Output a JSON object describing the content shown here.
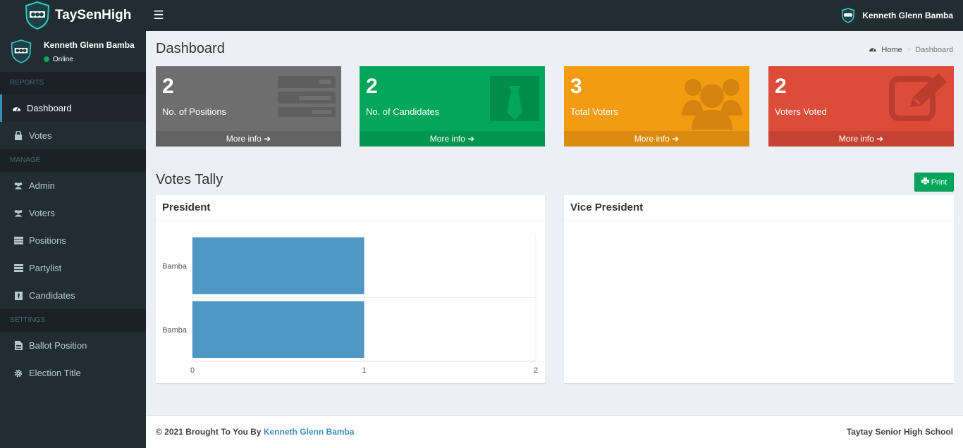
{
  "brand": {
    "name": "TaySenHigh"
  },
  "header": {
    "user_name": "Kenneth Glenn Bamba"
  },
  "sidebar": {
    "user_name": "Kenneth Glenn Bamba",
    "status": "Online",
    "sections": [
      {
        "title": "REPORTS",
        "items": [
          {
            "label": "Dashboard",
            "icon": "dashboard-icon"
          },
          {
            "label": "Votes",
            "icon": "lock-icon"
          }
        ]
      },
      {
        "title": "MANAGE",
        "items": [
          {
            "label": "Admin",
            "icon": "users-icon"
          },
          {
            "label": "Voters",
            "icon": "users-icon"
          },
          {
            "label": "Positions",
            "icon": "tasks-icon"
          },
          {
            "label": "Partylist",
            "icon": "tasks-icon"
          },
          {
            "label": "Candidates",
            "icon": "black-tie-icon"
          }
        ]
      },
      {
        "title": "SETTINGS",
        "items": [
          {
            "label": "Ballot Position",
            "icon": "file-text-icon"
          },
          {
            "label": "Election Title",
            "icon": "cog-icon"
          }
        ]
      }
    ]
  },
  "page": {
    "title": "Dashboard",
    "breadcrumb": {
      "home": "Home",
      "current": "Dashboard"
    }
  },
  "stats": [
    {
      "value": "2",
      "label": "No. of Positions",
      "more": "More info",
      "color": "#6e6e6e"
    },
    {
      "value": "2",
      "label": "No. of Candidates",
      "more": "More info",
      "color": "#00a65a"
    },
    {
      "value": "3",
      "label": "Total Voters",
      "more": "More info",
      "color": "#f39c12"
    },
    {
      "value": "2",
      "label": "Voters Voted",
      "more": "More info",
      "color": "#dd4b39"
    }
  ],
  "tally": {
    "title": "Votes Tally",
    "print_label": "Print"
  },
  "panels": [
    {
      "title": "President"
    },
    {
      "title": "Vice President"
    }
  ],
  "chart_data": {
    "type": "bar",
    "orientation": "horizontal",
    "categories": [
      "Bamba",
      "Bamba"
    ],
    "values": [
      1,
      1
    ],
    "xlim": [
      0,
      2
    ],
    "xticks": [
      0,
      1,
      2
    ],
    "color": "#4e96c4",
    "grid": true
  },
  "footer": {
    "left_prefix": "© 2021 Brought To You By",
    "left_link": "Kenneth Glenn Bamba",
    "right": "Taytay Senior High School"
  }
}
